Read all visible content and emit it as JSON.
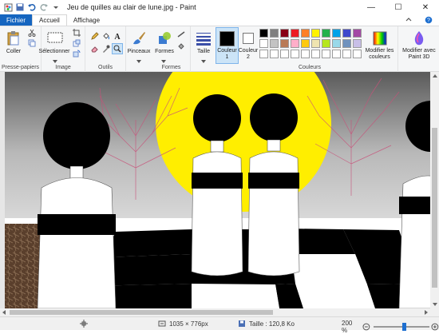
{
  "window": {
    "title": "Jeu de quilles au clair de lune.jpg - Paint",
    "minimize": "—",
    "maximize": "☐",
    "close": "✕"
  },
  "tabs": [
    {
      "label": "Fichier"
    },
    {
      "label": "Accueil"
    },
    {
      "label": "Affichage"
    }
  ],
  "ribbon": {
    "clipboard": {
      "paste_label": "Coller",
      "group_label": "Presse-papiers"
    },
    "image": {
      "select_label": "Sélectionner",
      "group_label": "Image"
    },
    "tools": {
      "group_label": "Outils"
    },
    "brushes": {
      "label": "Pinceaux"
    },
    "shapes": {
      "label": "Formes",
      "group_label": "Formes"
    },
    "size": {
      "label": "Taille"
    },
    "color1": {
      "label1": "Couleur",
      "label2": "1"
    },
    "color2": {
      "label1": "Couleur",
      "label2": "2"
    },
    "colors": {
      "group_label": "Couleurs"
    },
    "edit_colors": {
      "label1": "Modifier les",
      "label2": "couleurs"
    },
    "paint3d": {
      "label1": "Modifier avec",
      "label2": "Paint 3D"
    },
    "palette_row1": [
      "#000000",
      "#7f7f7f",
      "#880015",
      "#ed1c24",
      "#ff7f27",
      "#fff200",
      "#22b14c",
      "#00a2e8",
      "#3f48cc",
      "#a349a4"
    ],
    "palette_row2": [
      "#ffffff",
      "#c3c3c3",
      "#b97a57",
      "#ffaec9",
      "#ffc90e",
      "#efe4b0",
      "#b5e61d",
      "#99d9ea",
      "#7092be",
      "#c8bfe7"
    ],
    "palette_row1_extra": [
      "#000000",
      "#7f7f7f",
      "#c3c3c3",
      "#ff80c0",
      "#ffff80",
      "#ffe000",
      "#80c000",
      "#0080c0",
      "#4040c0",
      "#a0a0ff"
    ],
    "color1_value": "#000000",
    "color2_value": "#ffffff"
  },
  "status": {
    "dimensions": "1035 × 776px",
    "size": "Taille : 120,8 Ko",
    "zoom": "200 %"
  }
}
